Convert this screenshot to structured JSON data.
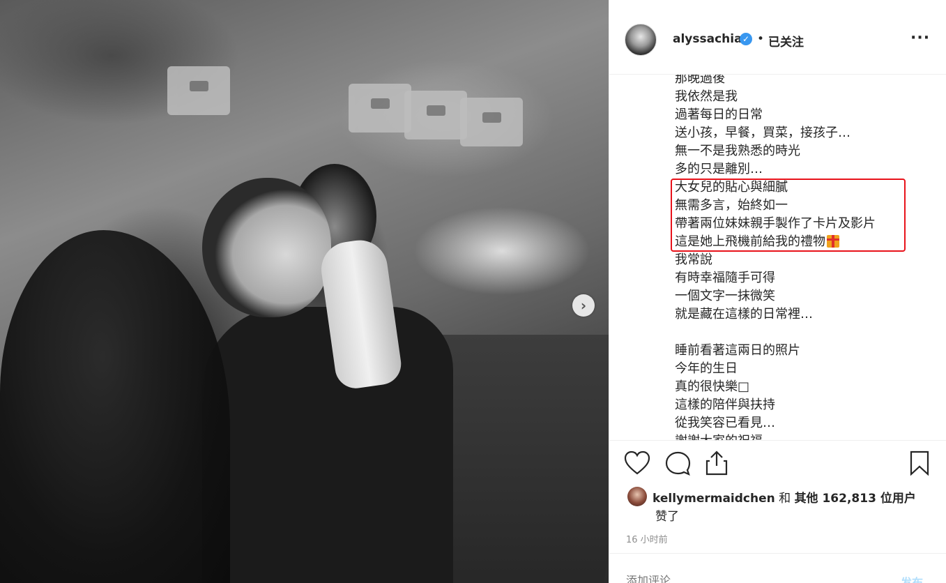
{
  "post": {
    "username": "alyssachia",
    "follow_label": "已关注",
    "separator": "•",
    "more_icon": "more-horizontal-icon",
    "verified_icon": "verified-badge-icon"
  },
  "caption_lines": [
    "那晚過後",
    "我依然是我",
    "過著每日的日常",
    "送小孩，早餐，買菜，接孩子…",
    "無一不是我熟悉的時光",
    "多的只是離別…",
    "大女兒的貼心與細膩",
    "無需多言，始終如一",
    "帶著兩位妹妹親手製作了卡片及影片",
    "這是她上飛機前給我的禮物",
    "我常說",
    "有時幸福隨手可得",
    "一個文字一抹微笑",
    "就是藏在這樣的日常裡…",
    "",
    "睡前看著這兩日的照片",
    "今年的生日",
    "真的很快樂□",
    "這樣的陪伴與扶持",
    "從我笑容已看見…",
    "謝謝大家的祝福"
  ],
  "likes": {
    "user": "kellymermaidchen",
    "connector": " 和 ",
    "others": "其他 162,813 位用户",
    "suffix": "赞了"
  },
  "timestamp": "16 小时前",
  "comment": {
    "placeholder": "添加评论...",
    "post_label": "发布"
  },
  "colors": {
    "highlight_box": "#e8121a",
    "verified": "#3897f0",
    "post_button": "#b2dffc"
  }
}
